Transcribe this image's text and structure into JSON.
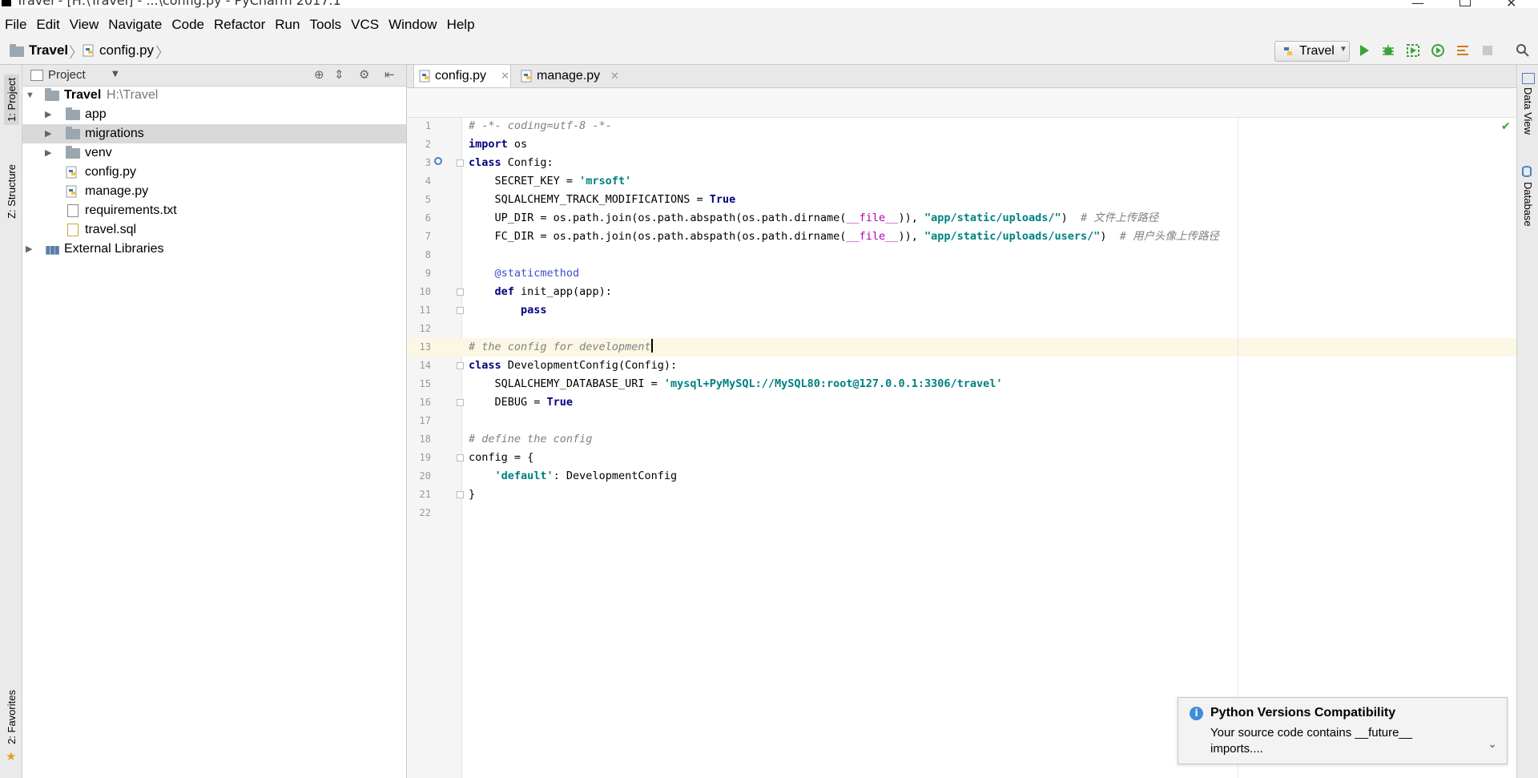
{
  "window": {
    "title": "Travel - [H:\\Travel] - ...\\config.py - PyCharm 2017.1"
  },
  "menu": [
    "File",
    "Edit",
    "View",
    "Navigate",
    "Code",
    "Refactor",
    "Run",
    "Tools",
    "VCS",
    "Window",
    "Help"
  ],
  "breadcrumb": {
    "project": "Travel",
    "file": "config.py"
  },
  "run_config": {
    "label": "Travel"
  },
  "left_tabs": {
    "project": "1: Project",
    "structure": "Z: Structure",
    "favorites": "2: Favorites"
  },
  "right_tabs": {
    "data_view": "Data View",
    "database": "Database"
  },
  "project_panel": {
    "header": "Project",
    "root": {
      "name": "Travel",
      "path": "H:\\Travel"
    },
    "items": [
      {
        "name": "app",
        "type": "folder"
      },
      {
        "name": "migrations",
        "type": "folder"
      },
      {
        "name": "venv",
        "type": "folder"
      },
      {
        "name": "config.py",
        "type": "python"
      },
      {
        "name": "manage.py",
        "type": "python"
      },
      {
        "name": "requirements.txt",
        "type": "text"
      },
      {
        "name": "travel.sql",
        "type": "sql"
      }
    ],
    "external": "External Libraries"
  },
  "tabs": [
    {
      "label": "config.py",
      "active": true
    },
    {
      "label": "manage.py",
      "active": false
    }
  ],
  "code_lines": [
    "# -*- coding=utf-8 -*-",
    "import os",
    "class Config:",
    "    SECRET_KEY = 'mrsoft'",
    "    SQLALCHEMY_TRACK_MODIFICATIONS = True",
    "    UP_DIR = os.path.join(os.path.abspath(os.path.dirname(__file__)), \"app/static/uploads/\")  # 文件上传路径",
    "    FC_DIR = os.path.join(os.path.abspath(os.path.dirname(__file__)), \"app/static/uploads/users/\")  # 用户头像上传路径",
    "",
    "    @staticmethod",
    "    def init_app(app):",
    "        pass",
    "",
    "# the config for development",
    "class DevelopmentConfig(Config):",
    "    SQLALCHEMY_DATABASE_URI = 'mysql+PyMySQL://MySQL80:root@127.0.0.1:3306/travel'",
    "    DEBUG = True",
    "",
    "# define the config",
    "config = {",
    "    'default': DevelopmentConfig",
    "}",
    ""
  ],
  "notification": {
    "title": "Python Versions Compatibility",
    "body": "Your source code contains __future__ imports...."
  },
  "colors": {
    "keyword": "#000080",
    "string": "#008080",
    "comment": "#808080",
    "current_line": "#fbf7e4"
  }
}
